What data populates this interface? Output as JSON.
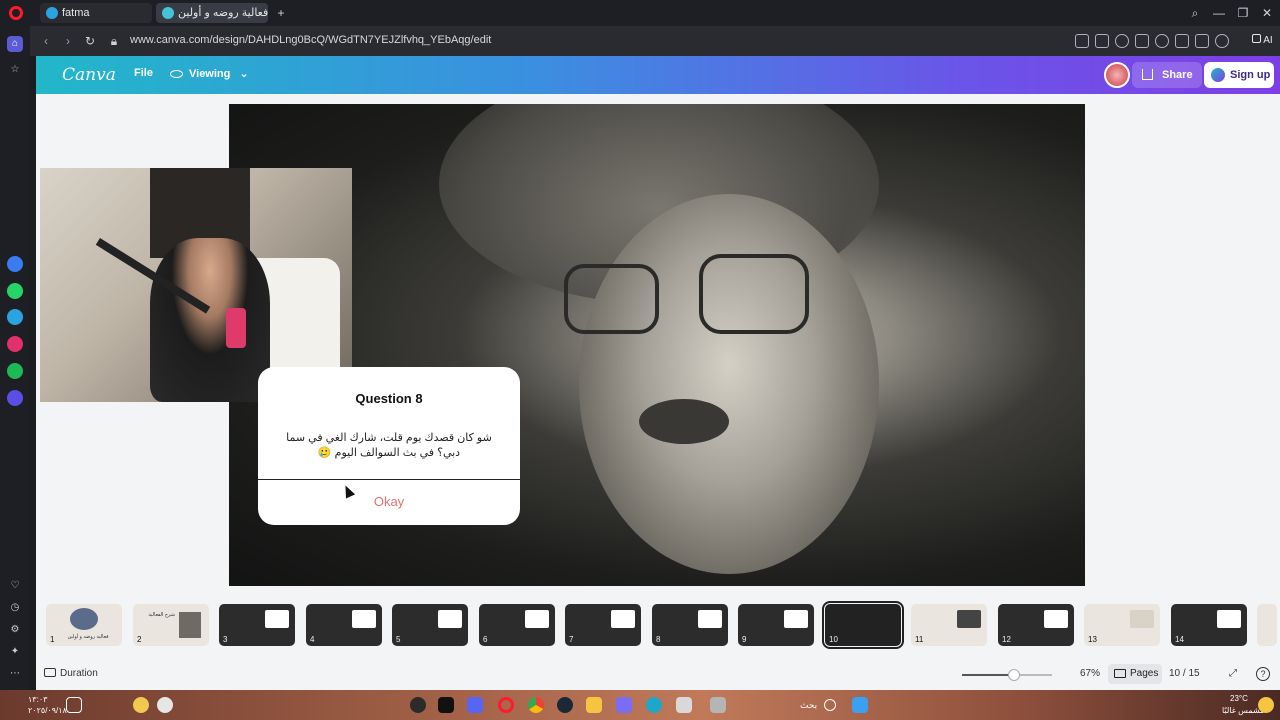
{
  "browser": {
    "tabs": [
      {
        "label": "fatma"
      },
      {
        "label": "فعالية روضه و أولين - ation"
      }
    ],
    "url": "www.canva.com/design/DAHDLng0BcQ/WGdTN7YEJZlfvhq_YEbAqg/edit",
    "ai_label": "AI"
  },
  "canva": {
    "logo": "Canva",
    "file_label": "File",
    "viewing_label": "Viewing",
    "share_label": "Share",
    "signup_label": "Sign up"
  },
  "dialog": {
    "title": "Question 8",
    "text": "شو كان قصدك يوم قلت، شارك الغي في سما دبي؟ في بث السوالف اليوم 🥲",
    "button": "Okay"
  },
  "thumbnails": [
    {
      "num": "1",
      "label": "فعالية روضه و أولين"
    },
    {
      "num": "2",
      "label": "شرح الفعالية"
    },
    {
      "num": "3"
    },
    {
      "num": "4"
    },
    {
      "num": "5"
    },
    {
      "num": "6"
    },
    {
      "num": "7"
    },
    {
      "num": "8"
    },
    {
      "num": "9"
    },
    {
      "num": "10"
    },
    {
      "num": "11"
    },
    {
      "num": "12"
    },
    {
      "num": "13"
    },
    {
      "num": "14"
    }
  ],
  "bottom": {
    "duration_label": "Duration",
    "zoom": "67%",
    "pages_label": "Pages",
    "page_count": "10 / 15"
  },
  "taskbar": {
    "time": "١٣:٠٣",
    "date": "٢٠٢٥/٠٩/١٨",
    "temp": "23°C",
    "weather": "مشمس غالبًا",
    "search": "بحث"
  },
  "colors": {
    "accent_okay": "#e46f6f",
    "header_start": "#22b7c9",
    "header_end": "#7e3ee6"
  }
}
